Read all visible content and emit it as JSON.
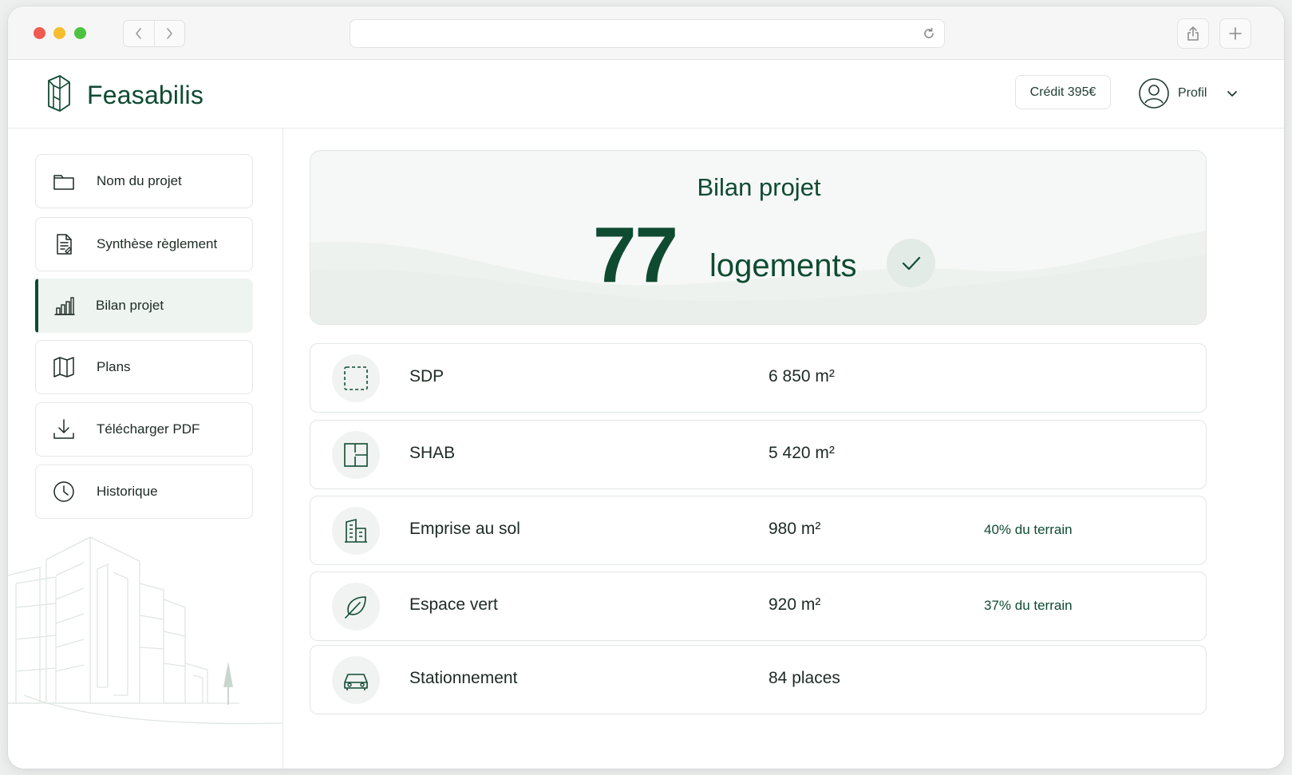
{
  "app": {
    "brand": "Feasabilis",
    "credit_label": "Crédit 395€",
    "profile_label": "Profil"
  },
  "sidebar": {
    "items": [
      {
        "label": "Nom du projet",
        "icon": "folder-icon",
        "active": false
      },
      {
        "label": "Synthèse règlement",
        "icon": "document-icon",
        "active": false
      },
      {
        "label": "Bilan projet",
        "icon": "bar-chart-icon",
        "active": true
      },
      {
        "label": "Plans",
        "icon": "map-icon",
        "active": false
      },
      {
        "label": "Télécharger PDF",
        "icon": "download-icon",
        "active": false
      },
      {
        "label": "Historique",
        "icon": "clock-icon",
        "active": false
      }
    ]
  },
  "hero": {
    "title": "Bilan projet",
    "count": "77",
    "unit": "logements",
    "status_icon": "check-icon"
  },
  "metrics": [
    {
      "label": "SDP",
      "value": "6 850 m²",
      "note": "",
      "icon": "dashed-square-icon"
    },
    {
      "label": "SHAB",
      "value": "5 420 m²",
      "note": "",
      "icon": "floorplan-icon"
    },
    {
      "label": "Emprise au sol",
      "value": "980 m²",
      "note": "40% du terrain",
      "icon": "building-icon"
    },
    {
      "label": "Espace vert",
      "value": "920 m²",
      "note": "37% du terrain",
      "icon": "leaf-icon"
    },
    {
      "label": "Stationnement",
      "value": "84 places",
      "note": "",
      "icon": "car-icon"
    }
  ],
  "colors": {
    "brand_green": "#0f4b31",
    "active_bg": "#eef4f0",
    "icon_circle": "#f0f3f1"
  }
}
